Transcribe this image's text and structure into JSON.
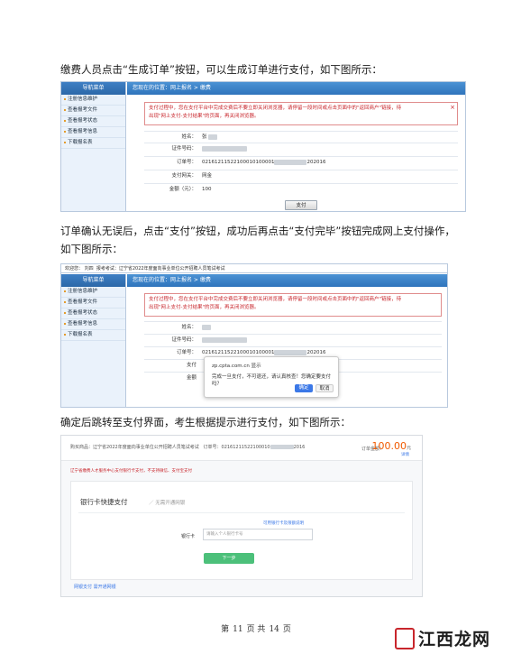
{
  "paragraphs": {
    "p1": "缴费人员点击“生成订单”按钮，可以生成订单进行支付，如下图所示：",
    "p2": "订单确认无误后，点击“支付”按钮，成功后再点击“支付完毕”按钮完成网上支付操作，如下图所示：",
    "p3": "确定后跳转至支付界面，考生根据提示进行支付，如下图所示："
  },
  "nav": {
    "title": "导航菜单",
    "items": [
      "注册信息维护",
      "查看报考文件",
      "查看报考状态",
      "查看报考信息",
      "下载报名表"
    ]
  },
  "shot1": {
    "breadcrumb": "您现在的位置：网上报名 > 缴费",
    "notice_line1": "支付过程中，您在支付平台中完成交费后不要立即关闭浏览器，请停留一段时间或点击页面中的\"返回商户\"链接，待",
    "notice_line2": "出现\"网上支付-支付结果\"的页面，再关闭浏览器。",
    "fields": [
      {
        "label": "姓名：",
        "value": "张",
        "masked": true
      },
      {
        "label": "证件号码：",
        "value": "",
        "masked": true
      },
      {
        "label": "订单号：",
        "value": "02161211522100010100001",
        "suffix": "202016",
        "masked": true
      },
      {
        "label": "支付网关：",
        "value": "网金",
        "masked": false
      },
      {
        "label": "金额（元）：",
        "value": "100",
        "masked": false
      }
    ],
    "pay_button": "支付"
  },
  "shot2": {
    "topstrip": "欢迎您：",
    "topstrip_name": "刘四",
    "topstrip_exam_label": "报考考试：",
    "topstrip_exam": "辽宁省2022年度面向事业单位公开招聘人员笔试考试",
    "breadcrumb": "您现在的位置：网上报名 > 缴费",
    "notice_line1": "支付过程中，您在支付平台中完成交费后不要立即关闭浏览器，请停留一段时间或点击页面中的\"返回商户\"链接，待",
    "notice_line2": "出现\"网上支付-支付结果\"的页面，再关闭浏览器。",
    "fields": [
      {
        "label": "姓名：",
        "value": "",
        "masked": true
      },
      {
        "label": "证件号码：",
        "value": "",
        "masked": true
      },
      {
        "label": "订单号：",
        "value": "02161211522100010100001",
        "suffix": "202016",
        "masked": true
      },
      {
        "label": "支付",
        "value": "",
        "masked": false
      },
      {
        "label": "金额",
        "value": "",
        "masked": false
      }
    ],
    "dialog": {
      "title": "zp.cpta.com.cn 显示",
      "message": "完成一旦支付，不可退还，请认真核查！您确定要支付吗？",
      "ok": "确定",
      "cancel": "取消"
    }
  },
  "shot3": {
    "order_text": "购买商品：辽宁省2022年度面向事业单位公开招聘人员笔试考试",
    "order_no": "订单号：02161211522100010",
    "order_no_suffix": "2016",
    "amount_label": "订单金额：",
    "amount": "100.00",
    "amount_unit": "元",
    "detail_link": "详情",
    "warning": "辽宁省缴费人才服务中心支付银行卡支付，不支持微信、支付宝支付",
    "title": "银行卡快捷支付",
    "subtitle": "／ 无需开通网银",
    "link": "可用银行卡及限额说明",
    "card_label": "银行卡",
    "card_placeholder": "请输入个人银行卡号",
    "next_button": "下一步",
    "netbank": "网银支付  需开通网银"
  },
  "footer": {
    "pre": "第",
    "page": "11",
    "mid": "页  共",
    "total": "14",
    "post": "页"
  },
  "watermark": {
    "text": "江西龙网"
  }
}
